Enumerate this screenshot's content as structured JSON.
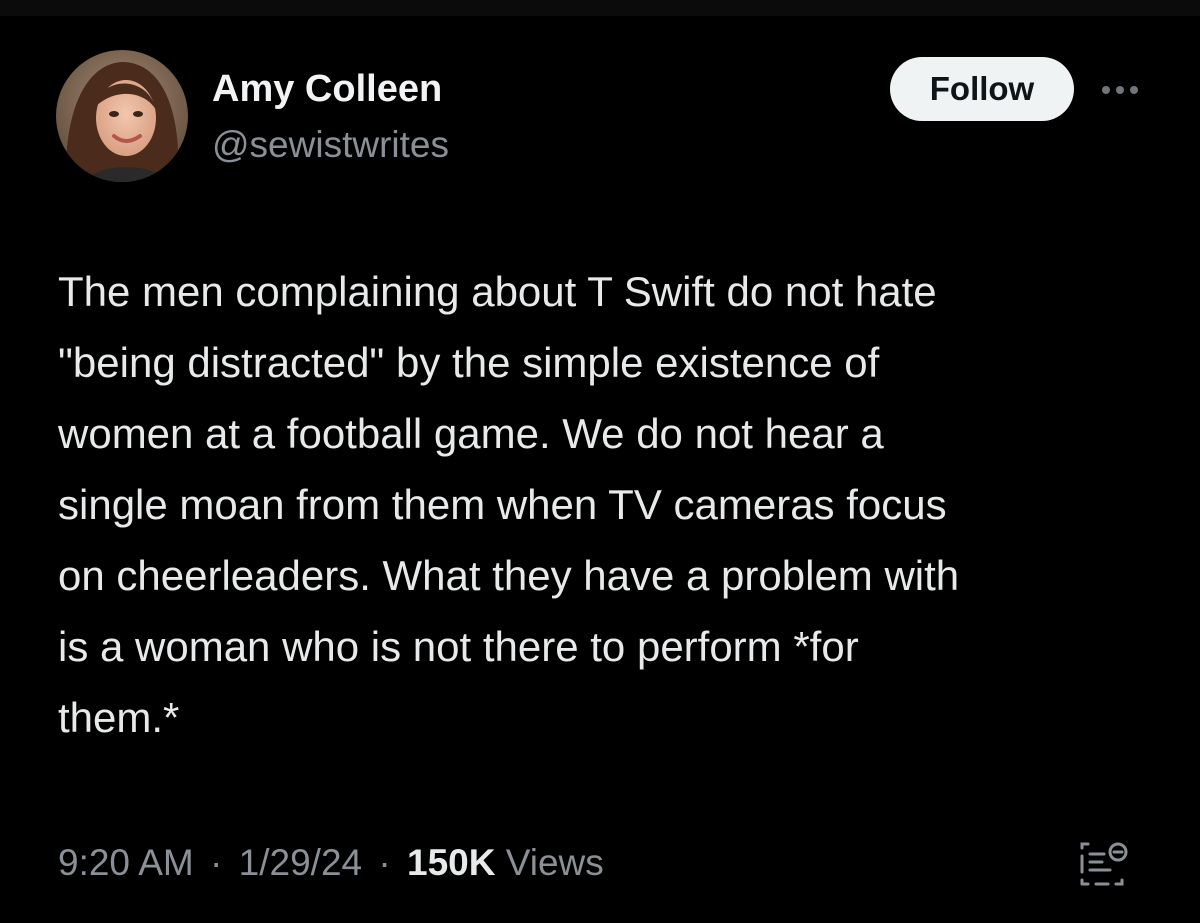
{
  "author": {
    "name": "Amy Colleen",
    "handle": "@sewistwrites",
    "avatar_icon": "profile-photo"
  },
  "actions": {
    "follow_label": "Follow",
    "more_icon": "more-horizontal-icon",
    "grok_icon": "grok-analysis-icon"
  },
  "tweet": {
    "lines": [
      "The men complaining about T Swift do not hate",
      "\"being distracted\" by the simple existence of",
      "women at a football game. We do not hear a",
      "single moan from them when TV cameras focus",
      "on cheerleaders. What they have a problem with",
      "is a woman who is not there to perform *for",
      "them.*"
    ]
  },
  "meta": {
    "time": "9:20 AM",
    "separator": "·",
    "date": "1/29/24",
    "views_count": "150K",
    "views_label": "Views"
  },
  "colors": {
    "background": "#000000",
    "text_primary": "#e7e9ea",
    "text_secondary": "#8b9096",
    "follow_bg": "#eff3f4"
  }
}
